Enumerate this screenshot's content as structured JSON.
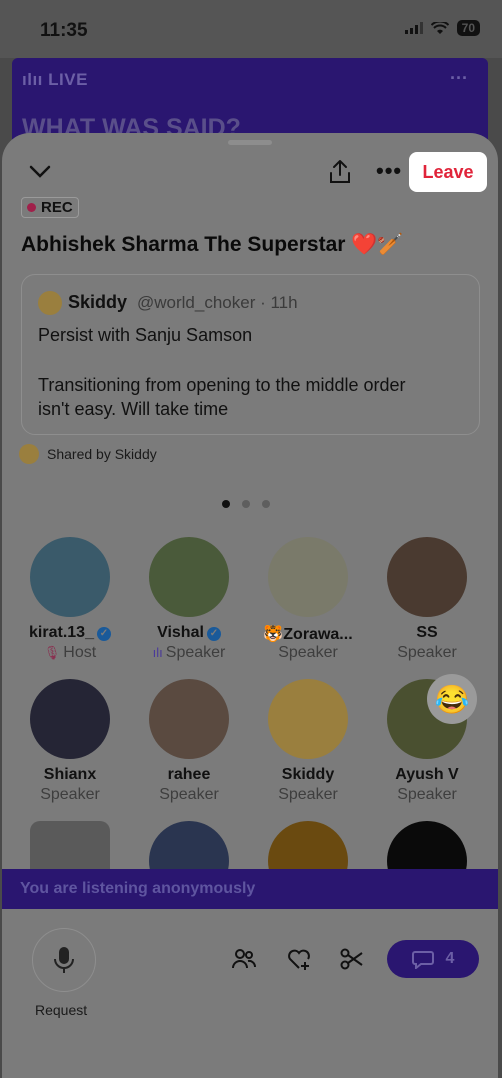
{
  "status_bar": {
    "time": "11:35",
    "battery": "70"
  },
  "banner": {
    "live_label": "LIVE",
    "title": "WHAT WAS SAID?"
  },
  "header": {
    "leave_label": "Leave",
    "rec_label": "REC"
  },
  "space": {
    "title": "Abhishek Sharma The Superstar",
    "title_emoji": "❤️🏏"
  },
  "tweet": {
    "author": "Skiddy",
    "handle": "@world_choker · 11h",
    "line1": "Persist with Sanju Samson",
    "line2": "Transitioning from opening to the middle order",
    "line3": "isn't easy. Will take time"
  },
  "shared_by": "Shared by Skiddy",
  "participants": [
    {
      "name": "kirat.13_",
      "role": "Host",
      "verified": true,
      "color": "#3a5a6a"
    },
    {
      "name": "Vishal",
      "role": "Speaker",
      "verified": true,
      "color": "#4a5a3a"
    },
    {
      "name": "Zorawa...",
      "role": "Speaker",
      "verified": false,
      "color": "#7a7a6a"
    },
    {
      "name": "SS",
      "role": "Speaker",
      "verified": false,
      "color": "#4a3a30"
    },
    {
      "name": "Shianx",
      "role": "Speaker",
      "verified": false,
      "color": "#252535"
    },
    {
      "name": "rahee",
      "role": "Speaker",
      "verified": false,
      "color": "#5a4a40"
    },
    {
      "name": "Skiddy",
      "role": "Speaker",
      "verified": false,
      "color": "#9a7f3e"
    },
    {
      "name": "Ayush V",
      "role": "Speaker",
      "verified": false,
      "color": "#4a5030"
    }
  ],
  "reaction_emoji": "😂",
  "anon_banner": "You are listening anonymously",
  "bottom": {
    "request_label": "Request",
    "comment_count": "4"
  }
}
